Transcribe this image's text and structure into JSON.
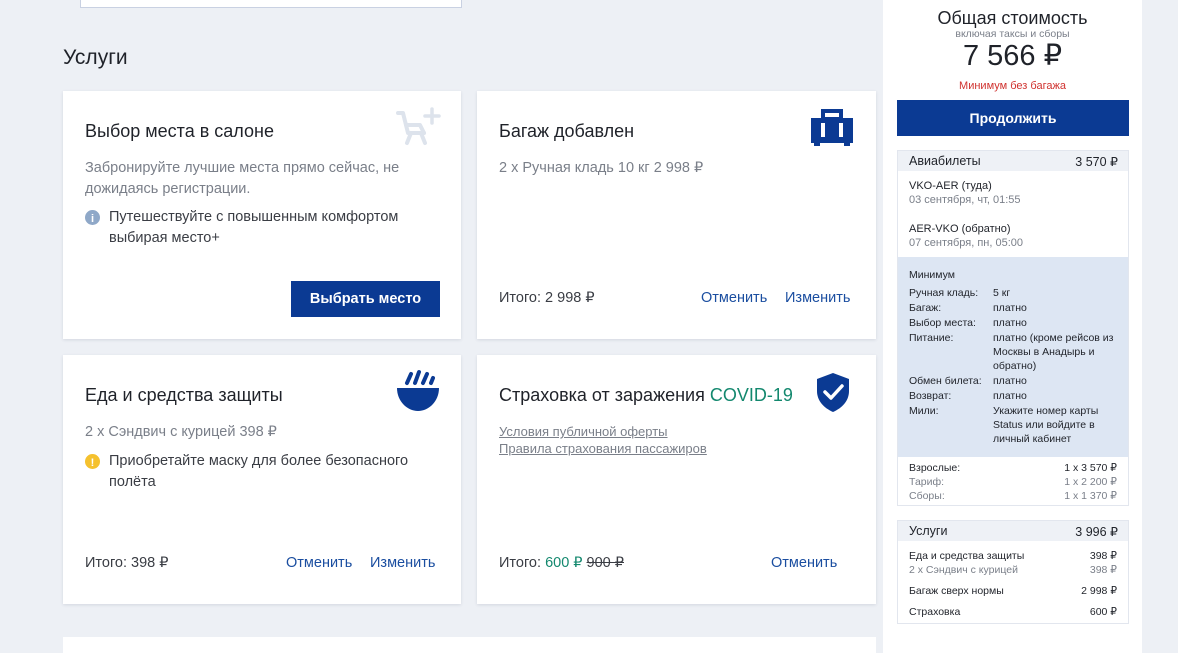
{
  "section_title": "Услуги",
  "cards": {
    "seat": {
      "title": "Выбор места в салоне",
      "desc_line1": "Забронируйте лучшие места прямо сейчас, не",
      "desc_line2": "дожидаясь регистрации.",
      "note_line1": "Путешествуйте с повышенным комфортом",
      "note_line2": "выбирая место+",
      "button": "Выбрать место",
      "icon": "seat-plus-icon"
    },
    "baggage": {
      "title": "Багаж добавлен",
      "desc": "2 x Ручная кладь 10 кг 2 998 ₽",
      "total": "Итого: 2 998 ₽",
      "cancel": "Отменить",
      "change": "Изменить",
      "icon": "suitcase-icon"
    },
    "food": {
      "title": "Еда и средства защиты",
      "desc": "2 x Сэндвич с курицей  398 ₽",
      "note_line1": "Приобретайте маску для более безопасного",
      "note_line2": "полёта",
      "total": "Итого: 398 ₽",
      "cancel": "Отменить",
      "change": "Изменить",
      "icon": "food-bowl-icon"
    },
    "insurance": {
      "title": "Страховка от заражения",
      "title_accent": "COVID-19",
      "link1": "Условия публичной оферты",
      "link2": "Правила страхования пассажиров",
      "total_prefix": "Итого:",
      "total_new": "600 ₽",
      "total_old": "900 ₽",
      "cancel": "Отменить",
      "icon": "shield-check-icon"
    }
  },
  "sidebar": {
    "title": "Общая стоимость",
    "subtitle": "включая таксы и сборы",
    "price": "7 566 ₽",
    "warning": "Минимум без багажа",
    "continue": "Продолжить",
    "tickets": {
      "label": "Авиабилеты",
      "amount": "3 570 ₽",
      "flights": [
        {
          "route": "VKO-AER (туда)",
          "date": "03 сентября, чт, 01:55"
        },
        {
          "route": "AER-VKO (обратно)",
          "date": "07 сентября, пн, 05:00"
        }
      ],
      "fare_name": "Минимум",
      "fare_rows": [
        {
          "k": "Ручная кладь:",
          "v": "5 кг"
        },
        {
          "k": "Багаж:",
          "v": "платно"
        },
        {
          "k": "Выбор места:",
          "v": "платно"
        },
        {
          "k": "Питание:",
          "v": "платно (кроме рейсов из Москвы в Анадырь и обратно)"
        },
        {
          "k": "Обмен билета:",
          "v": "платно"
        },
        {
          "k": "Возврат:",
          "v": "платно"
        },
        {
          "k": "Мили:",
          "v": "Укажите номер карты Status или войдите в личный кабинет"
        }
      ],
      "price_rows": [
        {
          "k": "Взрослые:",
          "v": "1 x 3 570 ₽"
        },
        {
          "k": "Тариф:",
          "v": "1 x 2 200 ₽"
        },
        {
          "k": "Сборы:",
          "v": "1 x 1 370 ₽"
        }
      ]
    },
    "services": {
      "label": "Услуги",
      "amount": "3 996 ₽",
      "rows": [
        {
          "k": "Еда и средства защиты",
          "v": "398 ₽"
        },
        {
          "k": "2 х Сэндвич с курицей",
          "v": "398 ₽"
        },
        {
          "k": "Багаж сверх нормы",
          "v": "2 998 ₽"
        },
        {
          "k": "Страховка",
          "v": "600 ₽"
        }
      ]
    }
  }
}
